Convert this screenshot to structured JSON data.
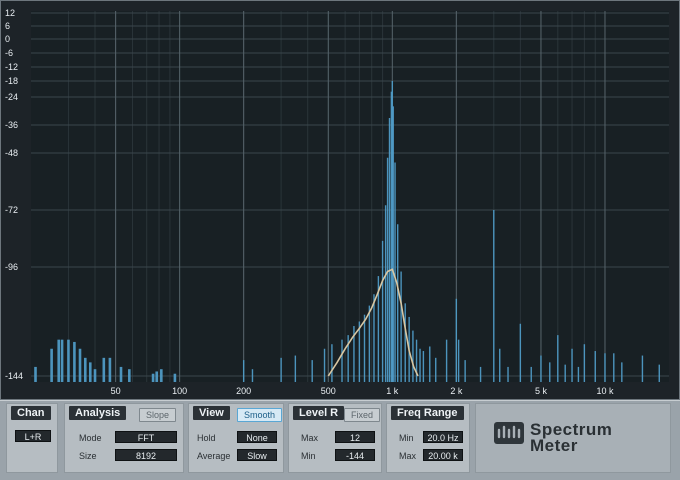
{
  "chart_data": {
    "type": "bar",
    "title": "",
    "xlabel": "",
    "ylabel": "",
    "y_scale": "dB",
    "x_scale": "log",
    "ylim": [
      -144,
      12
    ],
    "xlim": [
      20,
      20000
    ],
    "y_ticks": [
      12,
      6,
      0,
      -6,
      -12,
      -18,
      -24,
      -36,
      -48,
      -72,
      -96,
      -144
    ],
    "y_tick_labels": [
      "12",
      "6",
      "0",
      "-6",
      "-12",
      "-18",
      "-24",
      "-36",
      "-48",
      "-72",
      "-96",
      "-144"
    ],
    "x_ticks": [
      50,
      100,
      200,
      500,
      1000,
      2000,
      5000,
      10000
    ],
    "x_tick_labels": [
      "50",
      "100",
      "200",
      "500",
      "1 k",
      "2 k",
      "5 k",
      "10 k"
    ],
    "grid": true,
    "series": [
      {
        "style": "bars",
        "color": "#4f9bc6",
        "x": [
          21,
          25,
          27,
          28,
          30,
          32,
          34,
          36,
          38,
          40,
          44,
          47,
          53,
          58,
          75,
          78,
          82,
          95,
          200,
          220,
          300,
          350,
          420,
          480,
          520,
          580,
          620,
          660,
          700,
          740,
          780,
          820,
          860,
          900,
          930,
          950,
          970,
          990,
          1000,
          1010,
          1030,
          1060,
          1100,
          1150,
          1200,
          1250,
          1300,
          1350,
          1400,
          1500,
          1600,
          1800,
          2000,
          2050,
          2200,
          2600,
          3000,
          3200,
          3500,
          4000,
          4500,
          5000,
          5500,
          6000,
          6500,
          7000,
          7500,
          8000,
          9000,
          10000,
          11000,
          12000,
          15000,
          18000
        ],
        "values": [
          -140,
          -132,
          -128,
          -128,
          -128,
          -129,
          -132,
          -136,
          -138,
          -141,
          -136,
          -136,
          -140,
          -141,
          -143,
          -142,
          -141,
          -143,
          -137,
          -141,
          -136,
          -135,
          -137,
          -132,
          -130,
          -128,
          -126,
          -122,
          -120,
          -117,
          -113,
          -108,
          -100,
          -85,
          -70,
          -50,
          -33,
          -22,
          -18,
          -28,
          -52,
          -78,
          -98,
          -112,
          -118,
          -124,
          -128,
          -132,
          -133,
          -131,
          -136,
          -128,
          -110,
          -128,
          -137,
          -140,
          -72,
          -132,
          -140,
          -121,
          -140,
          -135,
          -138,
          -126,
          -139,
          -132,
          -140,
          -130,
          -133,
          -134,
          -134,
          -138,
          -135,
          -139
        ]
      },
      {
        "style": "line",
        "color": "#d8c7a3",
        "x": [
          500,
          550,
          600,
          650,
          700,
          750,
          800,
          850,
          900,
          950,
          1000,
          1050,
          1100,
          1150,
          1200,
          1260,
          1320
        ],
        "values": [
          -144,
          -138,
          -132,
          -127,
          -123,
          -119,
          -114,
          -108,
          -102,
          -98,
          -97,
          -103,
          -112,
          -123,
          -133,
          -140,
          -144
        ]
      }
    ]
  },
  "panel": {
    "chan": {
      "title": "Chan",
      "value": "L+R"
    },
    "analysis": {
      "title": "Analysis",
      "toggle": "Slope",
      "mode_label": "Mode",
      "mode_value": "FFT",
      "size_label": "Size",
      "size_value": "8192"
    },
    "view": {
      "title": "View",
      "toggle": "Smooth",
      "hold_label": "Hold",
      "hold_value": "None",
      "average_label": "Average",
      "average_value": "Slow"
    },
    "level": {
      "title": "Level R",
      "toggle": "Fixed",
      "max_label": "Max",
      "max_value": "12",
      "min_label": "Min",
      "min_value": "-144"
    },
    "freq": {
      "title": "Freq Range",
      "min_label": "Min",
      "min_value": "20.0 Hz",
      "max_label": "Max",
      "max_value": "20.00 k"
    },
    "brand": {
      "line1": "Spectrum",
      "line2": "Meter",
      "logo_icon": "presonus-logo-icon"
    }
  }
}
